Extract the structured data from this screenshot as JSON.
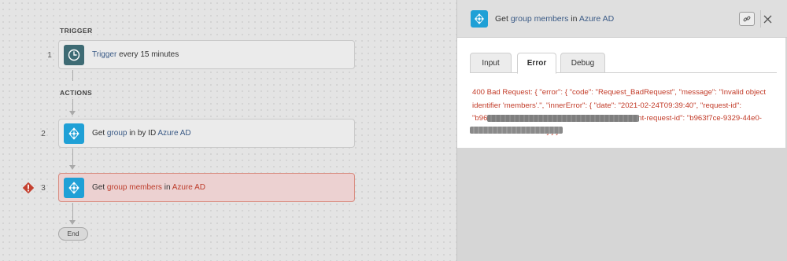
{
  "flow": {
    "trigger_heading": "TRIGGER",
    "actions_heading": "ACTIONS",
    "end_label": "End",
    "steps": [
      {
        "number": "1",
        "prefix": "",
        "keyword": "Trigger",
        "rest": " every 15 minutes",
        "icon": "clock-icon"
      },
      {
        "number": "2",
        "prefix": "Get ",
        "keyword": "group",
        "middle": " in by ID ",
        "app": "Azure AD",
        "icon": "azure-ad-icon"
      },
      {
        "number": "3",
        "prefix": "Get ",
        "keyword": "group members",
        "middle": " in ",
        "app": "Azure AD",
        "icon": "azure-ad-icon",
        "status": "error"
      }
    ]
  },
  "panel": {
    "title_prefix": "Get ",
    "title_keyword": "group members",
    "title_middle": " in ",
    "title_app": "Azure AD",
    "tabs": [
      {
        "label": "Input"
      },
      {
        "label": "Error",
        "active": true
      },
      {
        "label": "Debug"
      }
    ],
    "error_message": "400 Bad Request: { \"error\": { \"code\": \"Request_BadRequest\", \"message\": \"Invalid object identifier 'members'.\", \"innerError\": { \"date\": \"2021-02-24T09:39:40\", \"request-id\": \"b963f7ce-9329-44e0-b406-b67a4a417a1d\", \"client-request-id\": \"b963f7ce-9329-44e0-b406-b67a4a417a1d\" } } }"
  },
  "colors": {
    "keyword_blue": "#3a5a86",
    "error_red": "#c23b28",
    "azure_blue": "#1fa0d6",
    "clock_teal": "#3e6b74",
    "warning_red": "#c4402f"
  }
}
